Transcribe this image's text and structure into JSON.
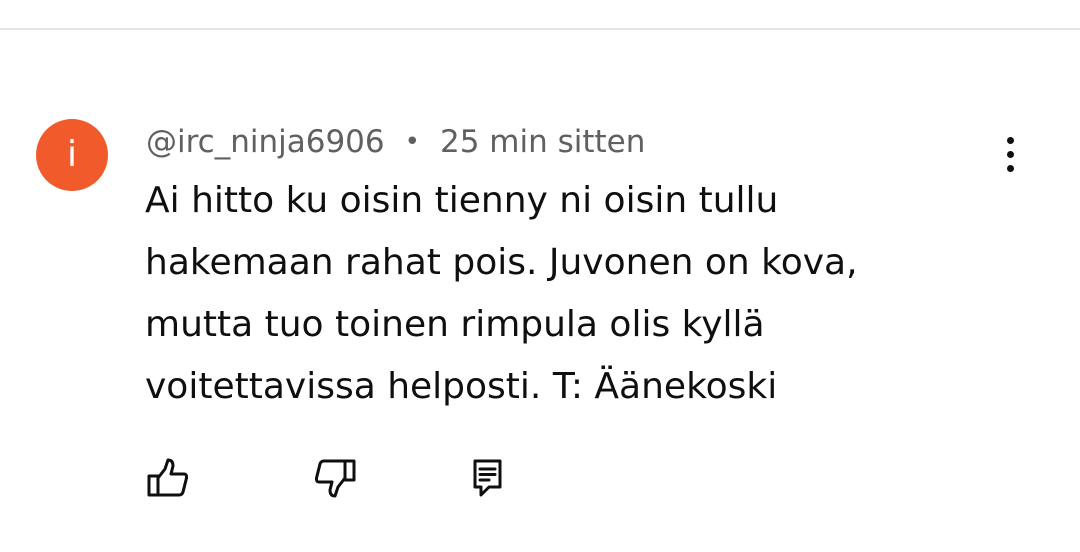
{
  "comment": {
    "avatar": {
      "letter": "i",
      "color": "#f15a2a"
    },
    "author": "@irc_ninja6906",
    "separator": "•",
    "timestamp": "25 min sitten",
    "text": "Ai hitto ku oisin tienny ni oisin tullu hakemaan rahat pois. Juvonen on kova, mutta tuo toinen rimpula olis kyllä voitettavissa helposti. T: Äänekoski"
  },
  "actions": {
    "like_icon": "thumbs-up-icon",
    "dislike_icon": "thumbs-down-icon",
    "reply_icon": "reply-comment-icon",
    "more_icon": "more-vertical-icon"
  }
}
